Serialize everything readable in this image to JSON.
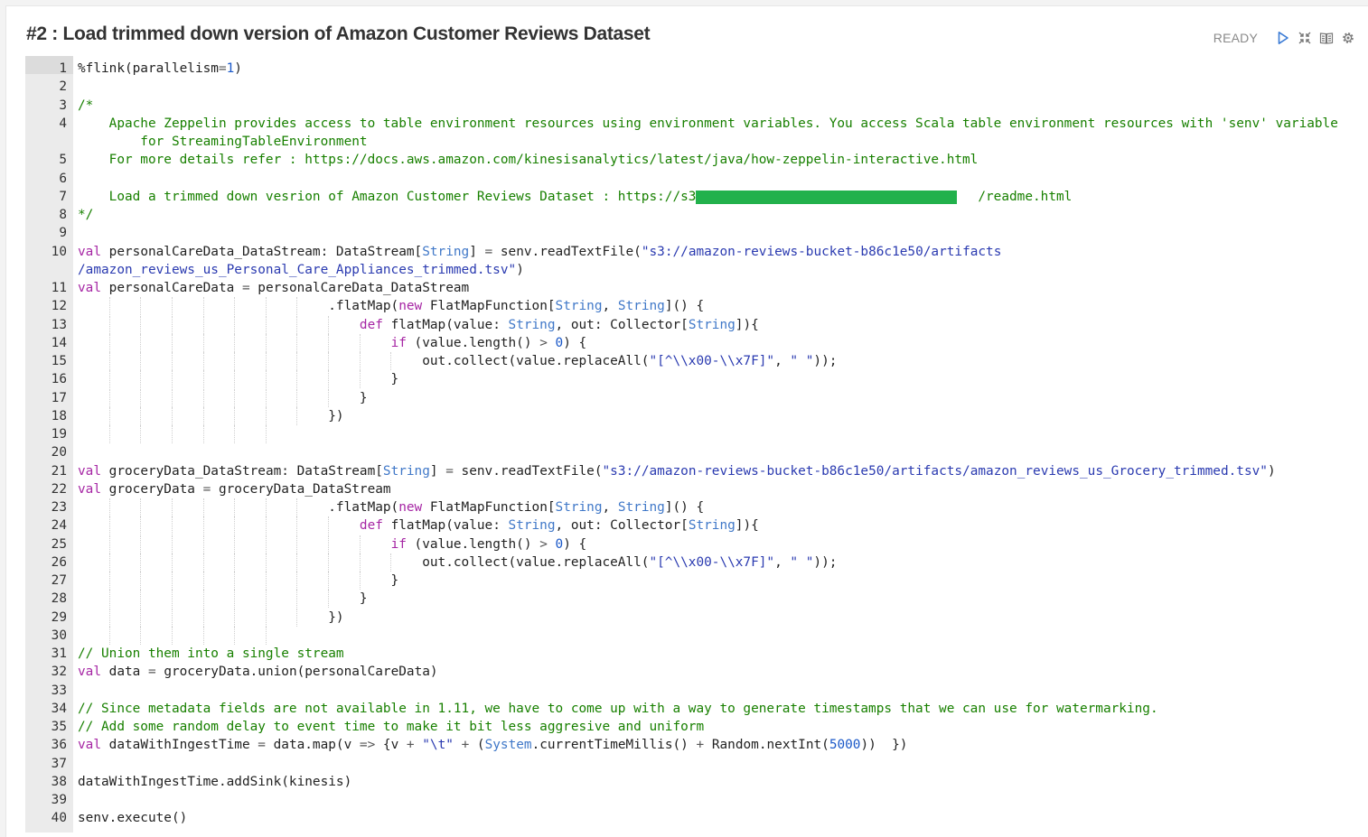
{
  "paragraph": {
    "title": "#2 : Load trimmed down version of Amazon Customer Reviews Dataset",
    "status": "READY",
    "controls": [
      {
        "name": "run-icon"
      },
      {
        "name": "collapse-icon"
      },
      {
        "name": "book-icon"
      },
      {
        "name": "gear-icon"
      }
    ]
  },
  "editor": {
    "lines": [
      {
        "n": "1",
        "parts": [
          [
            "plain",
            "%flink(parallelism"
          ],
          [
            "op",
            "="
          ],
          [
            "num",
            "1"
          ],
          [
            "plain",
            ")"
          ]
        ]
      },
      {
        "n": "2",
        "parts": []
      },
      {
        "n": "3",
        "parts": [
          [
            "cm",
            "/*"
          ]
        ]
      },
      {
        "n": "4",
        "parts": [
          [
            "cm",
            "    Apache Zeppelin provides access to table environment resources using environment variables. You access Scala table environment resources with 'senv' variable"
          ]
        ],
        "cont": [
          [
            "cm",
            "        for StreamingTableEnvironment"
          ]
        ]
      },
      {
        "n": "5",
        "parts": [
          [
            "cm",
            "    For more details refer : https://docs.aws.amazon.com/kinesisanalytics/latest/java/how-zeppelin-interactive.html"
          ]
        ]
      },
      {
        "n": "6",
        "parts": []
      },
      {
        "n": "7",
        "parts": [
          [
            "cm",
            "    Load a trimmed down vesrion of Amazon Customer Reviews Dataset : https://s3                                    /readme.html"
          ]
        ],
        "redacted": true
      },
      {
        "n": "8",
        "parts": [
          [
            "cm",
            "*/"
          ]
        ]
      },
      {
        "n": "9",
        "parts": []
      },
      {
        "n": "10",
        "parts": [
          [
            "kw",
            "val"
          ],
          [
            "plain",
            " personalCareData_DataStream: DataStream["
          ],
          [
            "ty",
            "String"
          ],
          [
            "plain",
            "] "
          ],
          [
            "op",
            "="
          ],
          [
            "plain",
            " senv.readTextFile("
          ],
          [
            "str",
            "\"s3://amazon-reviews-bucket-b86c1e50/artifacts"
          ]
        ],
        "cont": [
          [
            "str",
            "/amazon_reviews_us_Personal_Care_Appliances_trimmed.tsv\""
          ],
          [
            "plain",
            ")"
          ]
        ]
      },
      {
        "n": "11",
        "parts": [
          [
            "kw",
            "val"
          ],
          [
            "plain",
            " personalCareData "
          ],
          [
            "op",
            "="
          ],
          [
            "plain",
            " personalCareData_DataStream"
          ]
        ]
      },
      {
        "n": "12",
        "parts": [
          [
            "plain",
            "                                .flatMap("
          ],
          [
            "kw",
            "new"
          ],
          [
            "plain",
            " FlatMapFunction["
          ],
          [
            "ty",
            "String"
          ],
          [
            "plain",
            ", "
          ],
          [
            "ty",
            "String"
          ],
          [
            "plain",
            "]() {"
          ]
        ],
        "guides": 8
      },
      {
        "n": "13",
        "parts": [
          [
            "plain",
            "                                    "
          ],
          [
            "kw",
            "def"
          ],
          [
            "plain",
            " flatMap(value: "
          ],
          [
            "ty",
            "String"
          ],
          [
            "plain",
            ", out: Collector["
          ],
          [
            "ty",
            "String"
          ],
          [
            "plain",
            "]){"
          ]
        ],
        "guides": 9
      },
      {
        "n": "14",
        "parts": [
          [
            "plain",
            "                                        "
          ],
          [
            "kw",
            "if"
          ],
          [
            "plain",
            " (value.length() "
          ],
          [
            "op",
            ">"
          ],
          [
            "plain",
            " "
          ],
          [
            "num",
            "0"
          ],
          [
            "plain",
            ") {"
          ]
        ],
        "guides": 10
      },
      {
        "n": "15",
        "parts": [
          [
            "plain",
            "                                            out.collect(value.replaceAll("
          ],
          [
            "str",
            "\"[^\\\\x00-\\\\x7F]\""
          ],
          [
            "plain",
            ", "
          ],
          [
            "str",
            "\" \""
          ],
          [
            "plain",
            "));"
          ]
        ],
        "guides": 11
      },
      {
        "n": "16",
        "parts": [
          [
            "plain",
            "                                        }"
          ]
        ],
        "guides": 10
      },
      {
        "n": "17",
        "parts": [
          [
            "plain",
            "                                    }"
          ]
        ],
        "guides": 9
      },
      {
        "n": "18",
        "parts": [
          [
            "plain",
            "                                })"
          ]
        ],
        "guides": 8
      },
      {
        "n": "19",
        "parts": [],
        "guides": 7
      },
      {
        "n": "20",
        "parts": []
      },
      {
        "n": "21",
        "parts": [
          [
            "kw",
            "val"
          ],
          [
            "plain",
            " groceryData_DataStream: DataStream["
          ],
          [
            "ty",
            "String"
          ],
          [
            "plain",
            "] "
          ],
          [
            "op",
            "="
          ],
          [
            "plain",
            " senv.readTextFile("
          ],
          [
            "str",
            "\"s3://amazon-reviews-bucket-b86c1e50/artifacts/amazon_reviews_us_Grocery_trimmed.tsv\""
          ],
          [
            "plain",
            ")"
          ]
        ]
      },
      {
        "n": "22",
        "parts": [
          [
            "kw",
            "val"
          ],
          [
            "plain",
            " groceryData "
          ],
          [
            "op",
            "="
          ],
          [
            "plain",
            " groceryData_DataStream"
          ]
        ]
      },
      {
        "n": "23",
        "parts": [
          [
            "plain",
            "                                .flatMap("
          ],
          [
            "kw",
            "new"
          ],
          [
            "plain",
            " FlatMapFunction["
          ],
          [
            "ty",
            "String"
          ],
          [
            "plain",
            ", "
          ],
          [
            "ty",
            "String"
          ],
          [
            "plain",
            "]() {"
          ]
        ],
        "guides": 8
      },
      {
        "n": "24",
        "parts": [
          [
            "plain",
            "                                    "
          ],
          [
            "kw",
            "def"
          ],
          [
            "plain",
            " flatMap(value: "
          ],
          [
            "ty",
            "String"
          ],
          [
            "plain",
            ", out: Collector["
          ],
          [
            "ty",
            "String"
          ],
          [
            "plain",
            "]){"
          ]
        ],
        "guides": 9
      },
      {
        "n": "25",
        "parts": [
          [
            "plain",
            "                                        "
          ],
          [
            "kw",
            "if"
          ],
          [
            "plain",
            " (value.length() "
          ],
          [
            "op",
            ">"
          ],
          [
            "plain",
            " "
          ],
          [
            "num",
            "0"
          ],
          [
            "plain",
            ") {"
          ]
        ],
        "guides": 10
      },
      {
        "n": "26",
        "parts": [
          [
            "plain",
            "                                            out.collect(value.replaceAll("
          ],
          [
            "str",
            "\"[^\\\\x00-\\\\x7F]\""
          ],
          [
            "plain",
            ", "
          ],
          [
            "str",
            "\" \""
          ],
          [
            "plain",
            "));"
          ]
        ],
        "guides": 11
      },
      {
        "n": "27",
        "parts": [
          [
            "plain",
            "                                        }"
          ]
        ],
        "guides": 10
      },
      {
        "n": "28",
        "parts": [
          [
            "plain",
            "                                    }"
          ]
        ],
        "guides": 9
      },
      {
        "n": "29",
        "parts": [
          [
            "plain",
            "                                })"
          ]
        ],
        "guides": 8
      },
      {
        "n": "30",
        "parts": [],
        "guides": 7
      },
      {
        "n": "31",
        "parts": [
          [
            "cm",
            "// Union them into a single stream"
          ]
        ]
      },
      {
        "n": "32",
        "parts": [
          [
            "kw",
            "val"
          ],
          [
            "plain",
            " data "
          ],
          [
            "op",
            "="
          ],
          [
            "plain",
            " groceryData.union(personalCareData)"
          ]
        ]
      },
      {
        "n": "33",
        "parts": []
      },
      {
        "n": "34",
        "parts": [
          [
            "cm",
            "// Since metadata fields are not available in 1.11, we have to come up with a way to generate timestamps that we can use for watermarking."
          ]
        ]
      },
      {
        "n": "35",
        "parts": [
          [
            "cm",
            "// Add some random delay to event time to make it bit less aggresive and uniform"
          ]
        ]
      },
      {
        "n": "36",
        "parts": [
          [
            "kw",
            "val"
          ],
          [
            "plain",
            " dataWithIngestTime "
          ],
          [
            "op",
            "="
          ],
          [
            "plain",
            " data.map(v "
          ],
          [
            "op",
            "=>"
          ],
          [
            "plain",
            " {v "
          ],
          [
            "op",
            "+"
          ],
          [
            "plain",
            " "
          ],
          [
            "str",
            "\"\\t\""
          ],
          [
            "plain",
            " "
          ],
          [
            "op",
            "+"
          ],
          [
            "plain",
            " ("
          ],
          [
            "ty",
            "System"
          ],
          [
            "plain",
            ".currentTimeMillis() "
          ],
          [
            "op",
            "+"
          ],
          [
            "plain",
            " Random.nextInt("
          ],
          [
            "num",
            "5000"
          ],
          [
            "plain",
            "))  })"
          ]
        ]
      },
      {
        "n": "37",
        "parts": []
      },
      {
        "n": "38",
        "parts": [
          [
            "plain",
            "dataWithIngestTime.addSink(kinesis)"
          ]
        ]
      },
      {
        "n": "39",
        "parts": []
      },
      {
        "n": "40",
        "parts": [
          [
            "plain",
            "senv.execute()"
          ]
        ]
      }
    ]
  }
}
